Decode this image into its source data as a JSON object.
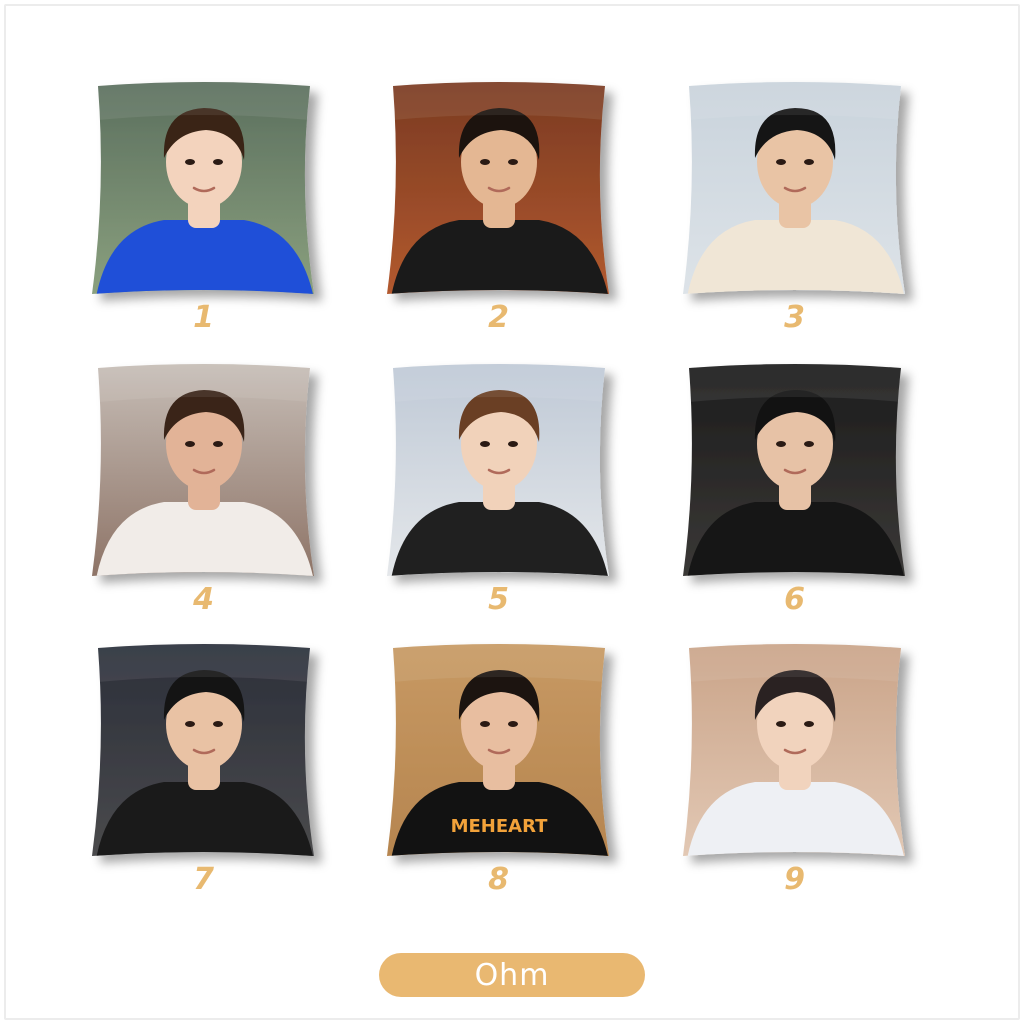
{
  "pillows": [
    {
      "label": "1",
      "palette": {
        "bg_top": "#5b6f5e",
        "bg_bottom": "#8aa07e",
        "skin": "#f3d3bd",
        "hair": "#3a2416",
        "shirt": "#1f4fd8"
      },
      "icon": "portrait-photo-icon"
    },
    {
      "label": "2",
      "palette": {
        "bg_top": "#7a3a22",
        "bg_bottom": "#b2592e",
        "skin": "#e4b793",
        "hair": "#1c130e",
        "shirt": "#1a1a1a"
      },
      "icon": "portrait-photo-icon"
    },
    {
      "label": "3",
      "palette": {
        "bg_top": "#c9d3dc",
        "bg_bottom": "#dde3e8",
        "skin": "#e9c4a5",
        "hair": "#151515",
        "shirt": "#f0e6d6"
      },
      "icon": "portrait-photo-icon"
    },
    {
      "label": "4",
      "palette": {
        "bg_top": "#c6bdb6",
        "bg_bottom": "#8e7467",
        "skin": "#e2b397",
        "hair": "#3a2418",
        "shirt": "#f1ece8"
      },
      "icon": "portrait-photo-icon"
    },
    {
      "label": "5",
      "palette": {
        "bg_top": "#bfc9d6",
        "bg_bottom": "#e4e7ea",
        "skin": "#f1d2ba",
        "hair": "#6a3f24",
        "shirt": "#202020"
      },
      "icon": "portrait-photo-icon"
    },
    {
      "label": "6",
      "palette": {
        "bg_top": "#1c1c1c",
        "bg_bottom": "#3a3836",
        "skin": "#e7c2a6",
        "hair": "#121212",
        "shirt": "#161616"
      },
      "icon": "portrait-photo-icon"
    },
    {
      "label": "7",
      "palette": {
        "bg_top": "#2b2f3a",
        "bg_bottom": "#4a4a4c",
        "skin": "#e9c2a4",
        "hair": "#141414",
        "shirt": "#1a1a1a"
      },
      "icon": "portrait-photo-icon"
    },
    {
      "label": "8",
      "palette": {
        "bg_top": "#c79963",
        "bg_bottom": "#b6854f",
        "skin": "#e8bea0",
        "hair": "#1c1410",
        "shirt": "#121212"
      },
      "icon": "portrait-photo-icon",
      "shirt_text": "MEHEART"
    },
    {
      "label": "9",
      "palette": {
        "bg_top": "#caa489",
        "bg_bottom": "#e2c8b4",
        "skin": "#f1d3bd",
        "hair": "#2a2222",
        "shirt": "#eef0f4"
      },
      "icon": "portrait-photo-icon"
    }
  ],
  "badge": {
    "label": "Ohm"
  },
  "colors": {
    "accent": "#e9b871",
    "number": "#e8b970",
    "background": "#ffffff"
  }
}
